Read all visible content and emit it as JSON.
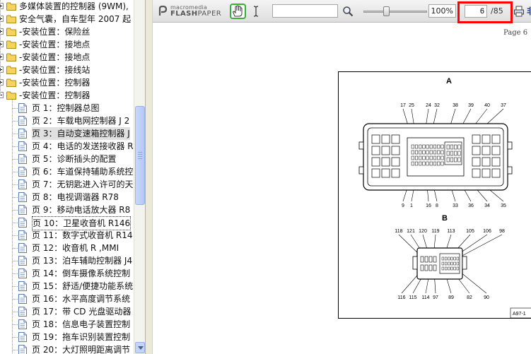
{
  "tree": {
    "folders_top": [
      {
        "label": "多媒体装置的控制器 (9WM),",
        "expander": "plus"
      },
      {
        "label": "安全气囊，自车型年 2007 起",
        "expander": "plus"
      },
      {
        "label": "-安装位置：保险丝",
        "expander": "plus"
      },
      {
        "label": "-安装位置：接地点",
        "expander": "plus"
      },
      {
        "label": "-安装位置：接地点",
        "expander": "plus"
      },
      {
        "label": "-安装位置：接线站",
        "expander": "plus"
      },
      {
        "label": "-安装位置：控制器",
        "expander": "plus"
      },
      {
        "label": "-安装位置：控制器",
        "expander": "minus"
      }
    ],
    "pages": [
      {
        "label": "页  1：控制器总图"
      },
      {
        "label": "页  2：车载电网控制器 J 2"
      },
      {
        "label": "页  3：自动变速箱控制器 J",
        "selected": true
      },
      {
        "label": "页  4：电话的发送接收器 R"
      },
      {
        "label": "页  5：诊断插头的配置"
      },
      {
        "label": "页  6：车道保持辅助系统控"
      },
      {
        "label": "页  7：无钥匙进入许可的天"
      },
      {
        "label": "页  8：电视调谐器  R78"
      },
      {
        "label": "页  9：移动电话放大器  R8"
      },
      {
        "label": "页  10：卫星收音机  R146",
        "focused": true
      },
      {
        "label": "页  11：数字式收音机  R14"
      },
      {
        "label": "页  12：收音机  R ,MMI"
      },
      {
        "label": "页  13：泊车辅助控制器  J4"
      },
      {
        "label": "页  14：倒车摄像系统控制"
      },
      {
        "label": "页  15：舒适/便捷功能系统"
      },
      {
        "label": "页  16：水平高度调节系统"
      },
      {
        "label": "页  17：带  CD 光盘驱动器"
      },
      {
        "label": "页  18：信息电子装置控制"
      },
      {
        "label": "页  19：拖车识别装置控制"
      },
      {
        "label": "页  20：大灯照明距离调节"
      }
    ]
  },
  "toolbar": {
    "logo_line1": "macromedia",
    "logo_line2_bold": "FLASH",
    "logo_line2_rest": "PAPER",
    "search_value": "",
    "zoom_percent": "100%",
    "zoom_fraction": 0.35,
    "current_page": "6",
    "page_total": "/85",
    "clipped_text": "非"
  },
  "document": {
    "page_label": "Page 6",
    "connector_a": {
      "title": "A",
      "top_pins": [
        "17",
        "25",
        "24",
        "32",
        "38",
        "39",
        "40",
        "37"
      ],
      "bottom_pins": [
        "9",
        "1",
        "16",
        "8",
        "33",
        "36",
        "34",
        "35"
      ]
    },
    "connector_b": {
      "title": "B",
      "top_pins": [
        "118",
        "121",
        "120",
        "119",
        "113",
        "105",
        "106",
        "98"
      ],
      "bottom_pins": [
        "116",
        "115",
        "114",
        "97",
        "89",
        "82",
        "90"
      ]
    },
    "figure_code": "A97-1"
  },
  "icons": {
    "folder": "folder-icon",
    "page": "page-icon",
    "hand": "hand-tool-icon",
    "text_select": "text-select-icon",
    "search": "magnifier-icon",
    "print": "printer-icon"
  },
  "colors": {
    "highlight_border": "#ff0000",
    "hand_border": "#35b035",
    "folder_fill": "#f4d35e"
  }
}
